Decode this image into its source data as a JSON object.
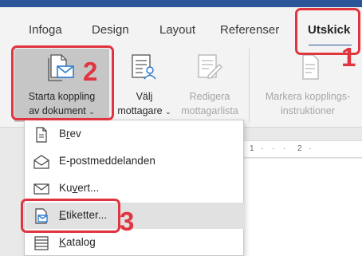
{
  "ribbon_tabs": {
    "infoga": "Infoga",
    "design": "Design",
    "layout": "Layout",
    "referenser": "Referenser",
    "utskick": "Utskick"
  },
  "ribbon_buttons": {
    "start_merge_line1": "Starta koppling",
    "start_merge_line2": "av dokument",
    "select_recipients_line1": "Välj",
    "select_recipients_line2": "mottagare",
    "edit_list_line1": "Redigera",
    "edit_list_line2": "mottagarlista",
    "highlight_fields_line1": "Markera kopplings-",
    "highlight_fields_line2": "instruktioner"
  },
  "ruler": {
    "t1": "1",
    "t2": "2"
  },
  "menu": {
    "items": [
      {
        "label_underlined": "",
        "label_rest": "Brev",
        "label_u": "r",
        "label_pre": "B",
        "label_post": "ev"
      },
      {
        "label_underlined": "",
        "label_rest": "E-postmeddelanden"
      },
      {
        "label_underlined": "",
        "label_rest": "Kuvert...",
        "label_pre": "Ku",
        "label_u": "v",
        "label_post": "ert..."
      },
      {
        "label_underlined": "",
        "label_rest": "Etiketter...",
        "label_pre": "",
        "label_u": "E",
        "label_post": "tiketter..."
      },
      {
        "label_underlined": "",
        "label_rest": "Katalog",
        "label_pre": "",
        "label_u": "K",
        "label_post": "atalog"
      }
    ],
    "highlighted_item": "Etiketter..."
  },
  "annotations": {
    "step1": "1",
    "step2": "2",
    "step3": "3",
    "color": "#e0343f"
  },
  "colors": {
    "accent": "#2b579a",
    "ribbon_bg": "#f3f3f3",
    "pressed_bg": "#c6c6c6",
    "menu_highlight": "#e1e1e1"
  }
}
